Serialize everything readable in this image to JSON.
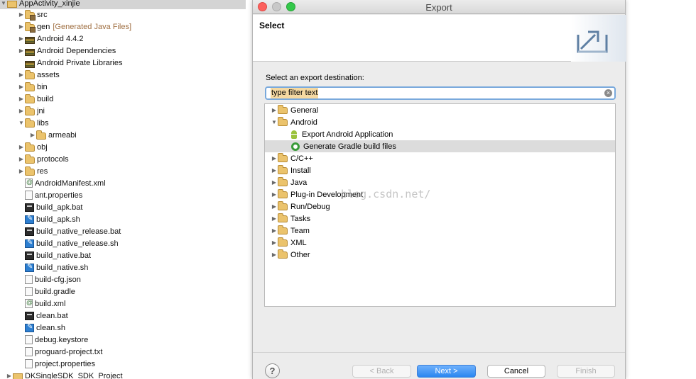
{
  "project_tree": {
    "root": {
      "label": "AppActivity_xinjie"
    },
    "items": [
      {
        "label": "src",
        "icon": "package-folder-icon"
      },
      {
        "label": "gen",
        "decoration": "[Generated Java Files]",
        "icon": "package-folder-icon"
      },
      {
        "label": "Android 4.4.2",
        "icon": "library-icon"
      },
      {
        "label": "Android Dependencies",
        "icon": "library-icon"
      },
      {
        "label": "Android Private Libraries",
        "icon": "library-icon"
      },
      {
        "label": "assets",
        "icon": "folder-icon"
      },
      {
        "label": "bin",
        "icon": "folder-icon"
      },
      {
        "label": "build",
        "icon": "folder-icon"
      },
      {
        "label": "jni",
        "icon": "folder-icon"
      },
      {
        "label": "libs",
        "icon": "folder-icon"
      },
      {
        "label": "armeabi",
        "icon": "folder-icon"
      },
      {
        "label": "obj",
        "icon": "folder-icon"
      },
      {
        "label": "protocols",
        "icon": "folder-icon"
      },
      {
        "label": "res",
        "icon": "folder-icon"
      },
      {
        "label": "AndroidManifest.xml",
        "icon": "xml-file-icon"
      },
      {
        "label": "ant.properties",
        "icon": "file-icon"
      },
      {
        "label": "build_apk.bat",
        "icon": "bat-file-icon"
      },
      {
        "label": "build_apk.sh",
        "icon": "sh-file-icon"
      },
      {
        "label": "build_native_release.bat",
        "icon": "bat-file-icon"
      },
      {
        "label": "build_native_release.sh",
        "icon": "sh-file-icon"
      },
      {
        "label": "build_native.bat",
        "icon": "bat-file-icon"
      },
      {
        "label": "build_native.sh",
        "icon": "sh-file-icon"
      },
      {
        "label": "build-cfg.json",
        "icon": "file-icon"
      },
      {
        "label": "build.gradle",
        "icon": "file-icon"
      },
      {
        "label": "build.xml",
        "icon": "xml-file-icon"
      },
      {
        "label": "clean.bat",
        "icon": "bat-file-icon"
      },
      {
        "label": "clean.sh",
        "icon": "sh-file-icon"
      },
      {
        "label": "debug.keystore",
        "icon": "file-icon"
      },
      {
        "label": "proguard-project.txt",
        "icon": "file-icon"
      },
      {
        "label": "project.properties",
        "icon": "file-icon"
      }
    ],
    "next_project": {
      "label": "DKSingleSDK_SDK_Project"
    }
  },
  "dialog": {
    "title": "Export",
    "header_title": "Select",
    "prompt": "Select an export destination:",
    "filter": {
      "placeholder": "type filter text",
      "value": "type filter text"
    },
    "items": [
      {
        "label": "General"
      },
      {
        "label": "Android"
      },
      {
        "label": "Export Android Application"
      },
      {
        "label": "Generate Gradle build files"
      },
      {
        "label": "C/C++"
      },
      {
        "label": "Install"
      },
      {
        "label": "Java"
      },
      {
        "label": "Plug-in Development"
      },
      {
        "label": "Run/Debug"
      },
      {
        "label": "Tasks"
      },
      {
        "label": "Team"
      },
      {
        "label": "XML"
      },
      {
        "label": "Other"
      }
    ],
    "buttons": {
      "back": "< Back",
      "next": "Next >",
      "cancel": "Cancel",
      "finish": "Finish"
    },
    "help": "?"
  },
  "watermark": "blog.csdn.net/",
  "colors": {
    "accent": "#2a86f0",
    "selection": "#dcdcdc",
    "filter_highlight": "#f5d9a2"
  }
}
